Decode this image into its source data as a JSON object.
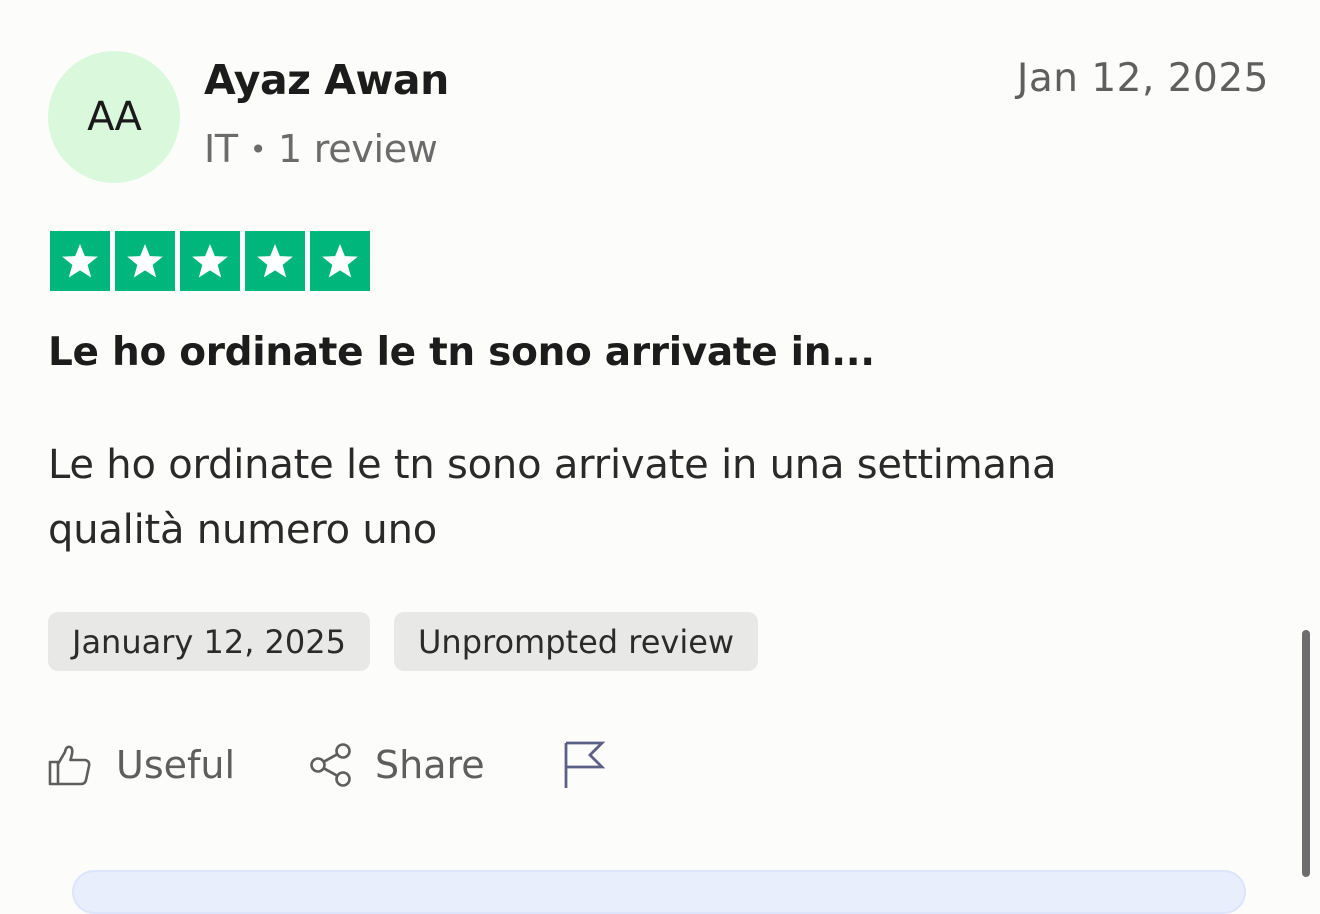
{
  "reviewer": {
    "initials": "AA",
    "name": "Ayaz Awan",
    "country": "IT",
    "review_count": "1 review",
    "avatar_color": "#d9f8dc"
  },
  "review": {
    "date_short": "Jan 12, 2025",
    "rating": 5,
    "max_rating": 5,
    "star_color": "#00b67a",
    "title": "Le ho ordinate le tn sono arrivate in...",
    "body": "Le ho ordinate le tn sono arrivate in una settimana qualità numero uno",
    "tags": [
      "January 12, 2025",
      "Unprompted review"
    ]
  },
  "actions": {
    "useful_label": "Useful",
    "share_label": "Share",
    "report_icon": "flag-icon"
  }
}
